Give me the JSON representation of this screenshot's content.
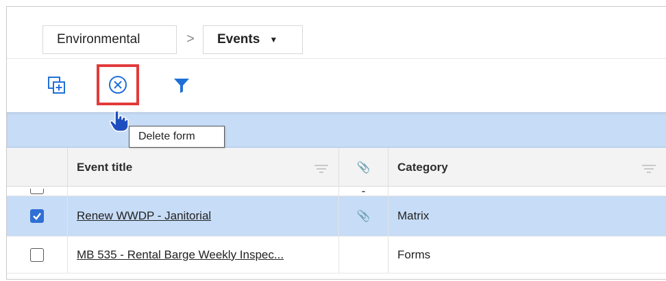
{
  "breadcrumb": {
    "item1": "Environmental",
    "separator": ">",
    "item2": "Events",
    "item2_caret": "▼"
  },
  "toolbar": {
    "add_icon": "copy-add-icon",
    "delete_icon": "circle-x-icon",
    "filter_icon": "filter-icon",
    "tooltip": "Delete form"
  },
  "table": {
    "columns": [
      {
        "label": "Event title"
      },
      {
        "label": ""
      },
      {
        "label": "Category"
      }
    ],
    "rows": [
      {
        "selected": false,
        "title": "",
        "attachment": "-",
        "category": ""
      },
      {
        "selected": true,
        "title": "Renew WWDP - Janitorial",
        "attachment": "📎",
        "category": "Matrix"
      },
      {
        "selected": false,
        "title": "MB 535 - Rental Barge Weekly Inspec...",
        "attachment": "",
        "category": "Forms"
      }
    ]
  },
  "colors": {
    "highlight": "#c7dcf6",
    "accent_blue": "#1f6fd8",
    "delete_outline": "#e23b3b",
    "header_bg": "#f3f3f3"
  }
}
